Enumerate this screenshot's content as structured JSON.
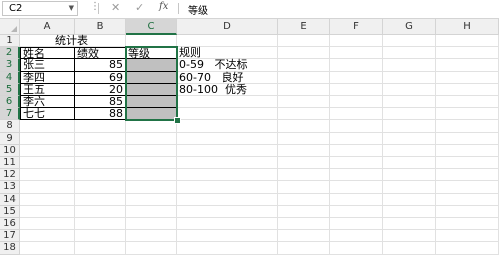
{
  "formula_bar": {
    "name_box": "C2",
    "cancel_icon": "✕",
    "enter_icon": "✓",
    "fx_label": "fx",
    "formula_value": "等级"
  },
  "columns": [
    "A",
    "B",
    "C",
    "D",
    "E",
    "F",
    "G",
    "H"
  ],
  "rows": [
    "1",
    "2",
    "3",
    "4",
    "5",
    "6",
    "7",
    "8",
    "9",
    "10",
    "11",
    "12",
    "13",
    "14",
    "15",
    "16",
    "17",
    "18"
  ],
  "cells": {
    "title": "统计表",
    "header_name": "姓名",
    "header_score": "绩效",
    "header_grade": "等级",
    "rules_label": "规则",
    "names": [
      "张三",
      "李四",
      "王五",
      "李六",
      "七七"
    ],
    "scores": [
      "85",
      "69",
      "20",
      "85",
      "88"
    ],
    "rules": [
      "0-59   不达标",
      "60-70   良好",
      "80-100  优秀"
    ]
  }
}
